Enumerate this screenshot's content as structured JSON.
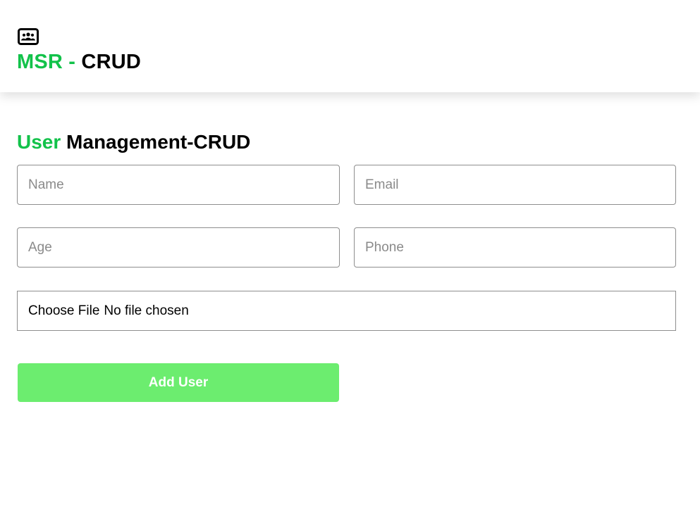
{
  "header": {
    "logo_icon": "users-id-card-icon",
    "brand_prefix": "MSR - ",
    "brand_suffix": "CRUD",
    "accent_color": "#12c24a"
  },
  "main": {
    "title_accent": "User",
    "title_rest": " Management-CRUD",
    "fields": {
      "name_placeholder": "Name",
      "email_placeholder": "Email",
      "age_placeholder": "Age",
      "phone_placeholder": "Phone"
    },
    "file": {
      "button_label": "Choose File",
      "status": "No file chosen"
    },
    "add_button_label": "Add User",
    "add_button_color": "#6ced6f"
  }
}
